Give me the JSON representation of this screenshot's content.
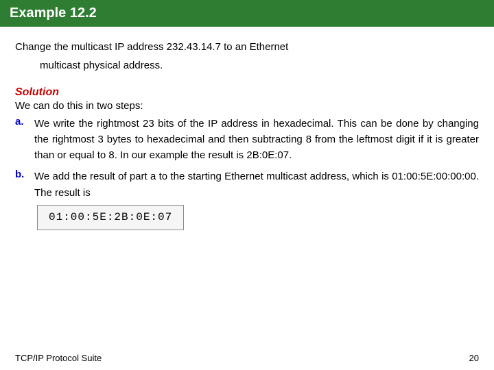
{
  "header": {
    "title": "Example 12.2",
    "bg_color": "#2e7d32"
  },
  "intro": {
    "line1": "Change  the  multicast  IP  address  232.43.14.7  to  an  Ethernet",
    "line2": "multicast physical address."
  },
  "solution": {
    "label": "Solution",
    "steps_intro": "We can do this in two steps:",
    "steps": [
      {
        "label": "a.",
        "text": "We write the rightmost 23 bits of the IP address in hexadecimal. This can be done by changing the rightmost 3 bytes to hexadecimal and then subtracting 8 from the leftmost digit if it is greater than or equal to 8. In our example the result is 2B:0E:07."
      },
      {
        "label": "b.",
        "text": "We add the result of part a to the starting Ethernet multicast address, which is 01:00:5E:00:00:00. The result is",
        "result": "01:00:5E:2B:0E:07"
      }
    ]
  },
  "footer": {
    "left": "TCP/IP Protocol Suite",
    "right": "20"
  }
}
